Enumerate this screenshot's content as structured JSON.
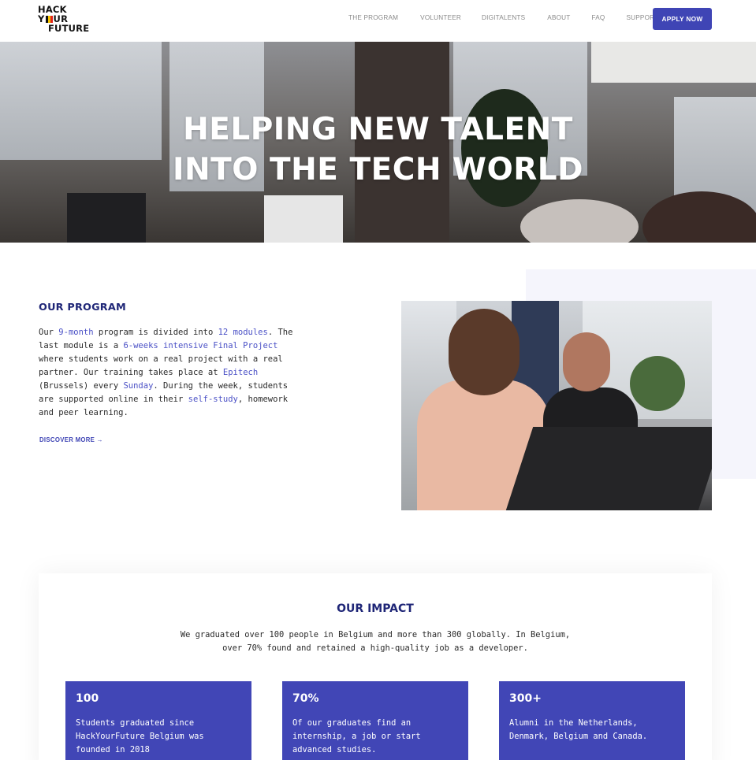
{
  "header": {
    "logo": {
      "line1": "HACK",
      "line2_left": "Y",
      "line2_right": "UR",
      "line3": "FUTURE",
      "flag_colors": [
        "#111111",
        "#f5c400",
        "#e2231a"
      ]
    },
    "nav": [
      "THE PROGRAM",
      "VOLUNTEER",
      "DIGITALENTS",
      "ABOUT",
      "FAQ",
      "SUPPORT US"
    ],
    "apply_label": "APPLY NOW"
  },
  "hero": {
    "line1": "HELPING NEW TALENT",
    "line2": "INTO THE TECH WORLD"
  },
  "program": {
    "title": "OUR PROGRAM",
    "text": [
      {
        "t": "Our "
      },
      {
        "t": "9-month",
        "hl": true
      },
      {
        "t": " program is divided into "
      },
      {
        "t": "12 modules",
        "hl": true
      },
      {
        "t": ". The last module is a "
      },
      {
        "t": "6-weeks intensive Final Project",
        "hl": true
      },
      {
        "t": " where students work on a real project with a real partner. Our training takes place at "
      },
      {
        "t": "Epitech",
        "hl": true
      },
      {
        "t": " (Brussels) every "
      },
      {
        "t": "Sunday",
        "hl": true
      },
      {
        "t": ". During the week, students are supported online in their "
      },
      {
        "t": "self-study",
        "hl": true
      },
      {
        "t": ", homework and peer learning."
      }
    ],
    "link": "DISCOVER MORE →"
  },
  "impact": {
    "title": "OUR IMPACT",
    "subtitle_line1": "We graduated over 100 people in Belgium and more than 300 globally. In Belgium,",
    "subtitle_line2": "over 70% found and retained a high-quality job as a developer.",
    "stats": [
      {
        "num": "100",
        "desc": "Students graduated since HackYourFuture Belgium was founded in 2018"
      },
      {
        "num": "70%",
        "desc": "Of our graduates find an internship, a job or start advanced studies."
      },
      {
        "num": "300+",
        "desc": "Alumni in the Netherlands, Denmark, Belgium and Canada."
      }
    ]
  },
  "colors": {
    "accent": "#3f45b5",
    "title": "#1f2677",
    "highlight": "#4a50c6"
  }
}
